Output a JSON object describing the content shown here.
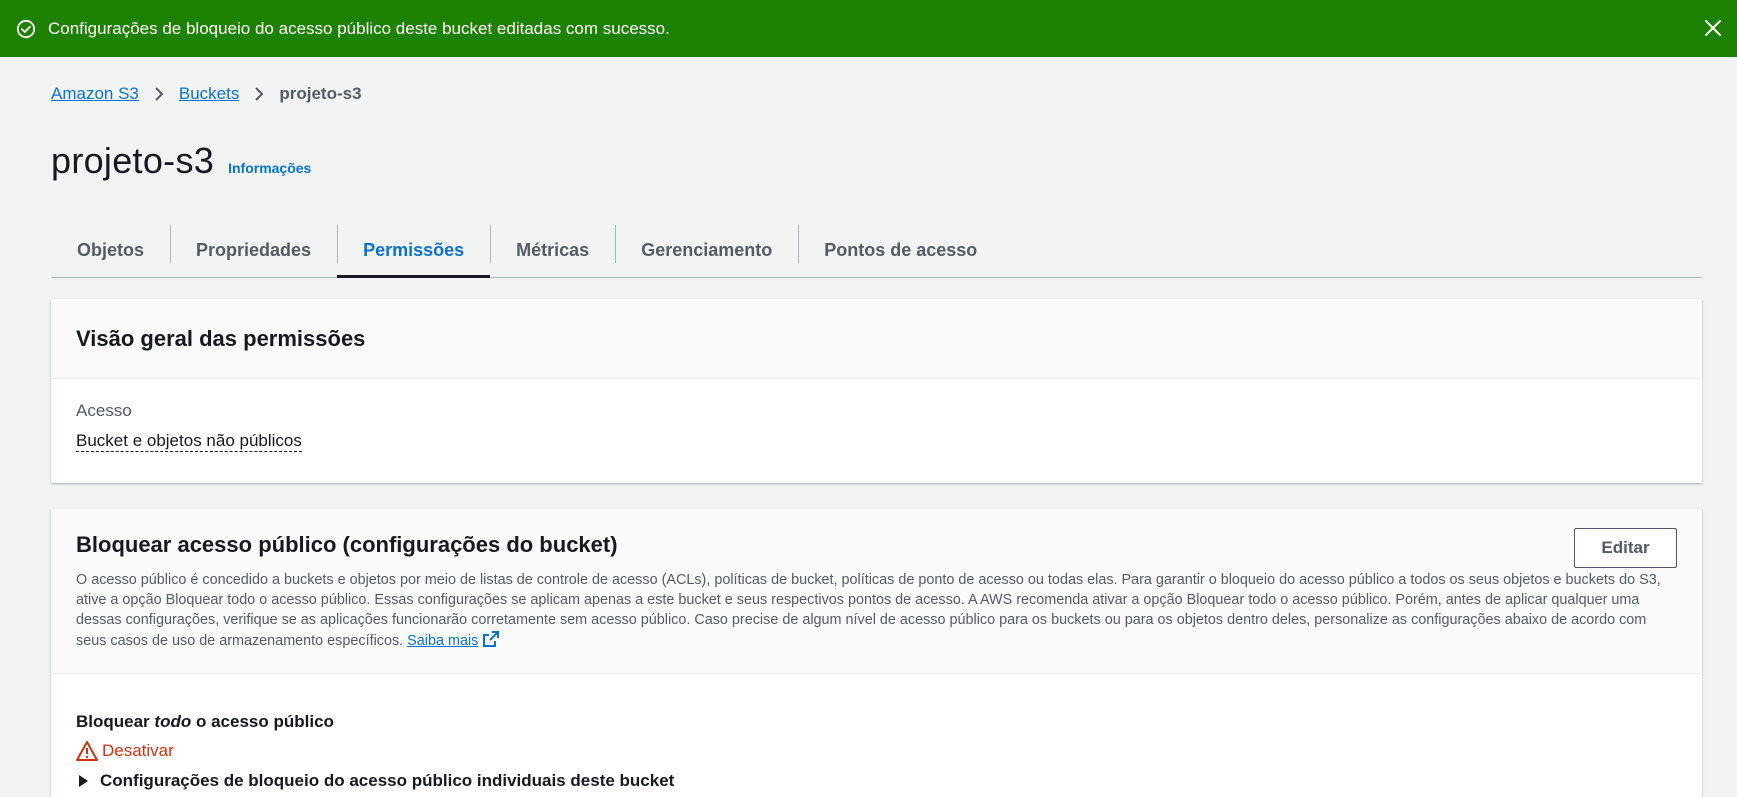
{
  "notification": {
    "message": "Configurações de bloqueio do acesso público deste bucket editadas com sucesso.",
    "icon": "check-circle-icon",
    "close_icon": "close-icon",
    "color": "#1d8102"
  },
  "breadcrumbs": {
    "items": [
      {
        "label": "Amazon S3"
      },
      {
        "label": "Buckets"
      },
      {
        "label": "projeto-s3"
      }
    ]
  },
  "header": {
    "title": "projeto-s3",
    "info_link": "Informações"
  },
  "tabs": [
    {
      "label": "Objetos"
    },
    {
      "label": "Propriedades"
    },
    {
      "label": "Permissões",
      "active": true
    },
    {
      "label": "Métricas"
    },
    {
      "label": "Gerenciamento"
    },
    {
      "label": "Pontos de acesso"
    }
  ],
  "overview": {
    "title": "Visão geral das permissões",
    "access_label": "Acesso",
    "access_value": "Bucket e objetos não públicos"
  },
  "block_public": {
    "title": "Bloquear acesso público (configurações do bucket)",
    "edit_label": "Editar",
    "description": "O acesso público é concedido a buckets e objetos por meio de listas de controle de acesso (ACLs), políticas de bucket, políticas de ponto de acesso ou todas elas. Para garantir o bloqueio do acesso público a todos os seus objetos e buckets do S3, ative a opção Bloquear todo o acesso público. Essas configurações se aplicam apenas a este bucket e seus respectivos pontos de acesso. A AWS recomenda ativar a opção Bloquear todo o acesso público. Porém, antes de aplicar qualquer uma dessas configurações, verifique se as aplicações funcionarão corretamente sem acesso público. Caso precise de algum nível de acesso público para os buckets ou para os objetos dentro deles, personalize as configurações abaixo de acordo com seus casos de uso de armazenamento específicos.",
    "learn_more": "Saiba mais",
    "setting_prefix": "Bloquear",
    "setting_emphasis": "todo",
    "setting_suffix": "o acesso público",
    "status": "Desativar",
    "status_color": "#d13212",
    "expander_label": "Configurações de bloqueio do acesso público individuais deste bucket"
  }
}
